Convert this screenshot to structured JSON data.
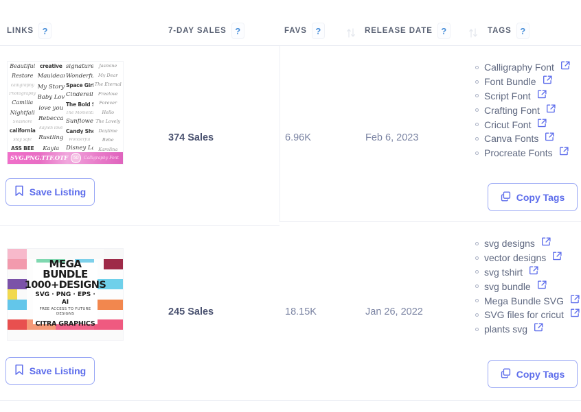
{
  "header": {
    "columns": [
      {
        "label": "LINKS",
        "help": "?"
      },
      {
        "label": "7-DAY SALES",
        "help": "?"
      },
      {
        "label": "FAVS",
        "help": "?"
      },
      {
        "label": "RELEASE DATE",
        "help": "?"
      },
      {
        "label": "TAGS",
        "help": "?"
      }
    ],
    "sort_icon": "sort-updown-icon"
  },
  "rows": [
    {
      "sales": "374 Sales",
      "favs": "6.96K",
      "release_date": "Feb 6, 2023",
      "save_label": "Save Listing",
      "copy_label": "Copy Tags",
      "thumbnail": {
        "type": "font-sampler",
        "banner_text": "SVG.PNG.TTF.OTF",
        "banner_badge": "50",
        "banner_sub": "Calligraphy Font Bundle",
        "samples_col1": [
          "Beautiful",
          "Restore",
          "calligraphy",
          "Photography",
          "Camilia",
          "Nightfall",
          "Seashore",
          "california",
          "stay safe",
          "ASS BEE"
        ],
        "samples_col2": [
          "creative",
          "Mauldean",
          "My Story",
          "Baby Love",
          "love you",
          "Rebecca",
          "kaylen love",
          "Rustling",
          "Kayla"
        ],
        "samples_col3": [
          "signature",
          "Wonderful",
          "Space Girls",
          "Cinderella",
          "The Bold Style",
          "The Moments",
          "Sunflower",
          "Candy Shop",
          "Wonderful",
          "Disney Land"
        ],
        "samples_col4": [
          "Jasmine",
          "My Dear",
          "The Eternal",
          "Freelove",
          "Forever",
          "Hello",
          "The Lovely",
          "Daytime",
          "Bebe",
          "Karolina"
        ]
      },
      "tags": [
        "Calligraphy Font",
        "Font Bundle",
        "Script Font",
        "Crafting Font",
        "Cricut Font",
        "Canva Fonts",
        "Procreate Fonts"
      ]
    },
    {
      "sales": "245 Sales",
      "favs": "18.15K",
      "release_date": "Jan 26, 2022",
      "save_label": "Save Listing",
      "copy_label": "Copy Tags",
      "thumbnail": {
        "type": "mega-bundle-collage",
        "line1": "MEGA BUNDLE",
        "line2": "1000+DESIGNS",
        "line3": "SVG · PNG · EPS · AI",
        "line4": "FREE ACCESS TO FUTURE DESIGNS",
        "line5": "CITRA GRAPHICS"
      },
      "tags": [
        "svg designs",
        "vector designs",
        "svg tshirt",
        "svg bundle",
        "Mega Bundle SVG",
        "SVG files for cricut",
        "plants svg"
      ]
    }
  ],
  "icons": {
    "bookmark": "bookmark-icon",
    "copy": "copy-icon",
    "external_link": "external-link-icon"
  },
  "colors": {
    "accent": "#5c6ceb",
    "header_text": "#5a6274",
    "body_text": "#5f6880",
    "sales_text": "#4a5270",
    "divider": "#e9ecf2",
    "help_blue": "#4a90d9"
  }
}
